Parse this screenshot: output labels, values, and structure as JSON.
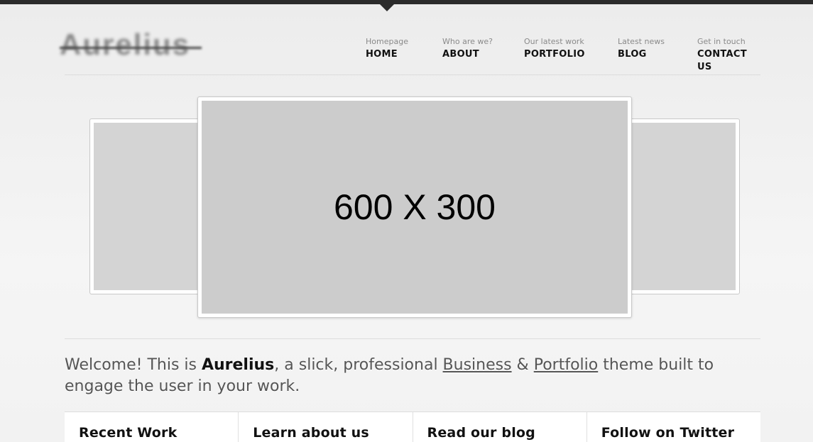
{
  "logo": {
    "text": "Aurelius"
  },
  "nav": {
    "items": [
      {
        "sub": "Homepage",
        "label": "HOME"
      },
      {
        "sub": "Who are we?",
        "label": "ABOUT"
      },
      {
        "sub": "Our latest work",
        "label": "PORTFOLIO"
      },
      {
        "sub": "Latest news",
        "label": "BLOG"
      },
      {
        "sub": "Get in touch",
        "label": "CONTACT US"
      }
    ]
  },
  "slider": {
    "main_label": "600 X 300"
  },
  "welcome": {
    "part1": "Welcome! This is ",
    "brand": "Aurelius",
    "part2": ", a slick, professional ",
    "link1": "Business",
    "part3": " & ",
    "link2": "Portfolio",
    "part4": " theme built to engage the user in your work."
  },
  "columns": [
    {
      "title": "Recent Work"
    },
    {
      "title": "Learn about us"
    },
    {
      "title": "Read our blog"
    },
    {
      "title": "Follow on Twitter"
    }
  ],
  "colors": {
    "topbar": "#2b2b2b",
    "background": "#f0f0f0",
    "slide_placeholder": "#cccccc"
  }
}
